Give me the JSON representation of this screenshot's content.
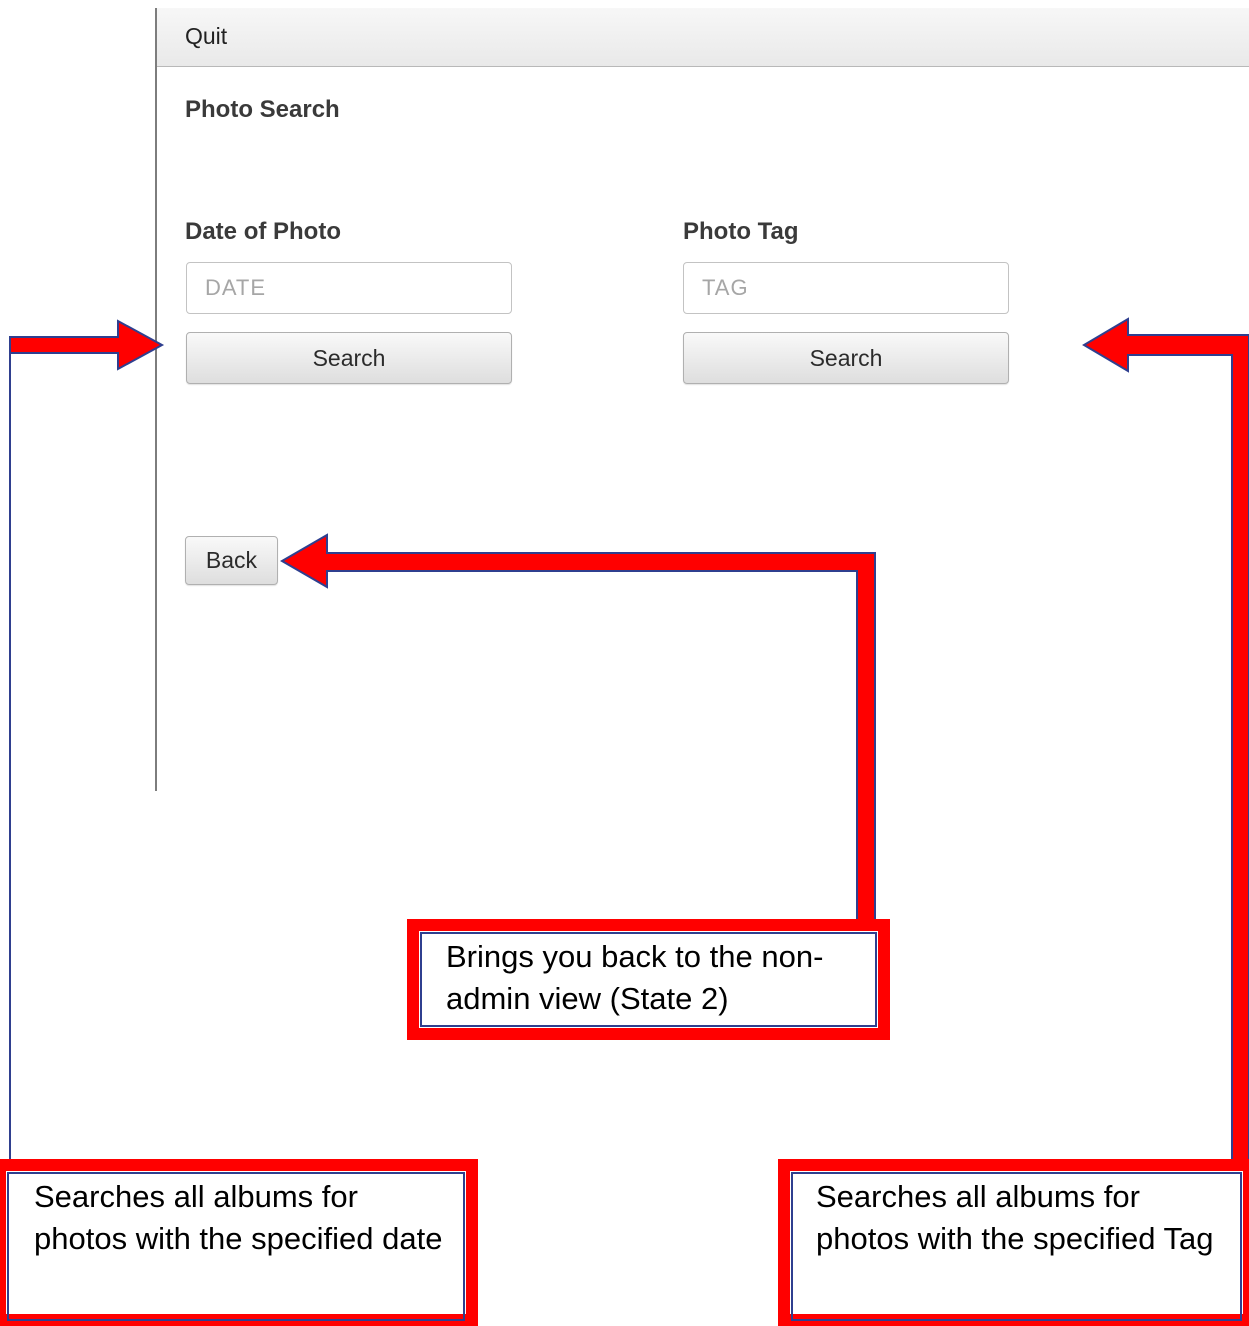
{
  "menu": {
    "quit_label": "Quit"
  },
  "window": {
    "title": "Photo Search"
  },
  "date_search": {
    "label": "Date of Photo",
    "placeholder": "DATE",
    "button_label": "Search"
  },
  "tag_search": {
    "label": "Photo Tag",
    "placeholder": "TAG",
    "button_label": "Search"
  },
  "back_button_label": "Back",
  "annotations": {
    "back_note": "Brings you back to the non-admin view (State 2)",
    "date_note": "Searches all albums for photos with the specified date",
    "tag_note": "Searches all albums for photos with the specified Tag"
  },
  "colors": {
    "arrow_fill": "#ff0000",
    "arrow_outline": "#2f3f8f"
  }
}
